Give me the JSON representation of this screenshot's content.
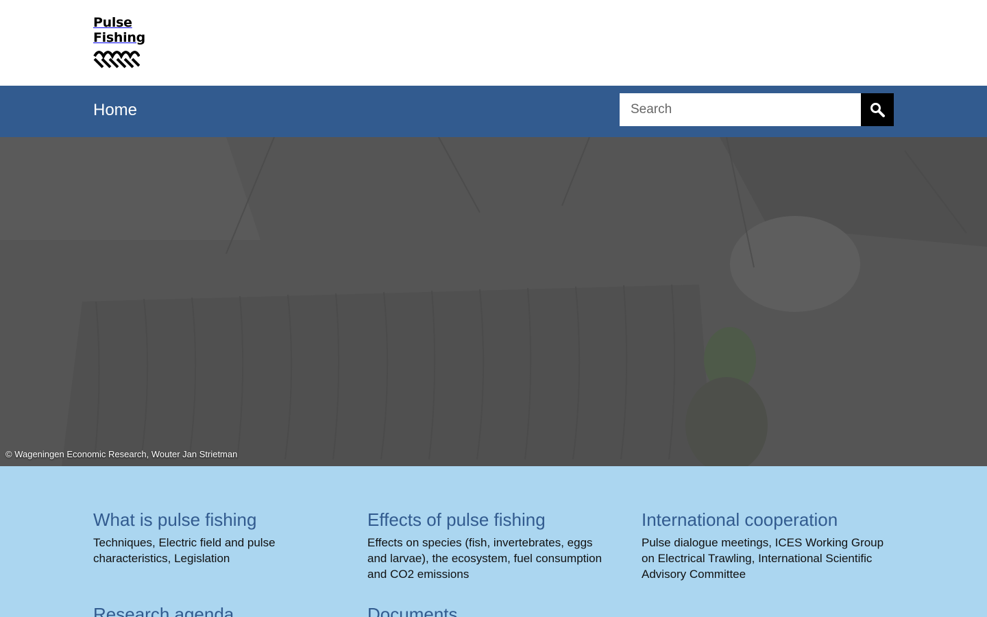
{
  "logo": {
    "line1": "Pulse",
    "line2": "Fishing"
  },
  "nav": {
    "home_label": "Home"
  },
  "search": {
    "placeholder": "Search"
  },
  "hero": {
    "credit": "© Wageningen Economic Research, Wouter Jan Strietman"
  },
  "tiles": [
    {
      "title": "What is pulse fishing",
      "desc": "Techniques, Electric field and pulse characteristics, Legislation"
    },
    {
      "title": "Effects of pulse fishing",
      "desc": "Effects on species (fish, invertebrates, eggs and larvae), the ecosystem, fuel consumption and CO2 emissions"
    },
    {
      "title": "International cooperation",
      "desc": "Pulse dialogue meetings, ICES Working Group on Electrical Trawling, International Scientific Advisory Committee"
    },
    {
      "title": "Research agenda",
      "desc": ""
    },
    {
      "title": "Documents",
      "desc": ""
    }
  ],
  "colors": {
    "nav": "#325b8f",
    "tiles_bg": "#abd6f0",
    "title": "#325b8f"
  }
}
